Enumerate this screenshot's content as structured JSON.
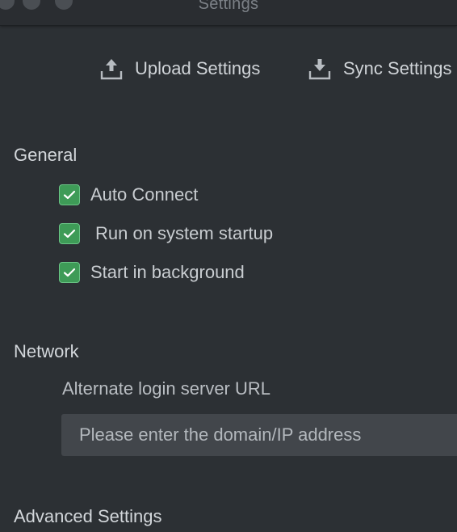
{
  "window": {
    "title": "Settings"
  },
  "toolbar": {
    "upload_label": "Upload Settings",
    "sync_label": "Sync Settings",
    "upload_icon": "upload-icon",
    "sync_icon": "download-icon"
  },
  "general": {
    "title": "General",
    "options": [
      {
        "label": "Auto Connect",
        "checked": true
      },
      {
        "label": "Run on system startup",
        "checked": true
      },
      {
        "label": "Start in background",
        "checked": true
      }
    ]
  },
  "network": {
    "title": "Network",
    "field_label": "Alternate login server URL",
    "field_value": "",
    "field_placeholder": "Please enter the domain/IP address"
  },
  "advanced": {
    "title": "Advanced Settings"
  },
  "colors": {
    "background": "#2c3034",
    "checkbox_green": "#3e9b57",
    "input_bg": "#42464b"
  }
}
